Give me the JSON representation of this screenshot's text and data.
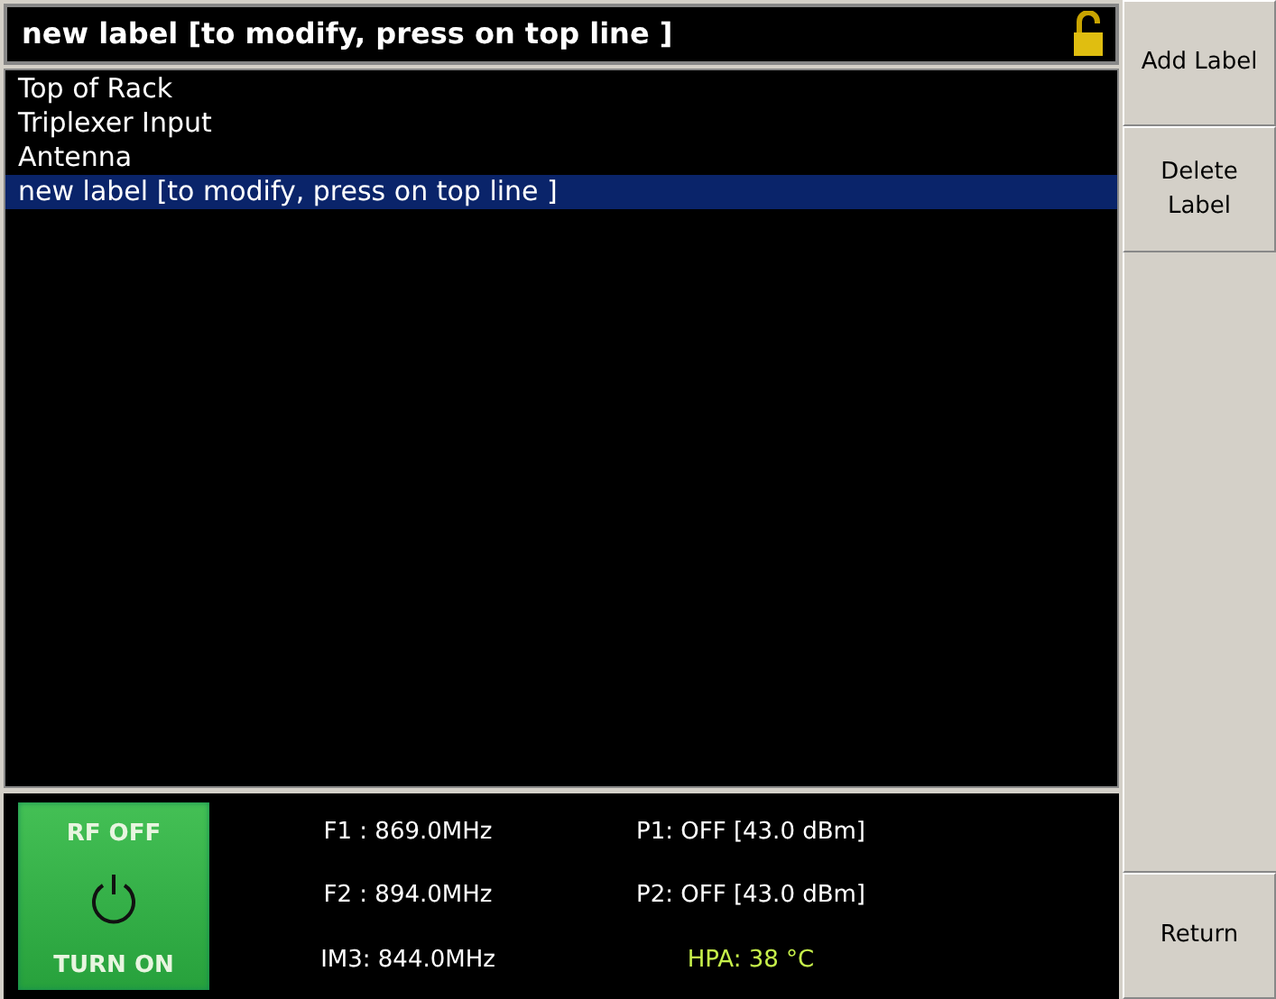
{
  "header": {
    "title": "new label [to modify, press on top line ]",
    "locked": false
  },
  "labels": [
    {
      "text": "Top of Rack",
      "selected": false
    },
    {
      "text": "Triplexer Input",
      "selected": false
    },
    {
      "text": "Antenna",
      "selected": false
    },
    {
      "text": "new label [to modify, press on top line ]",
      "selected": true
    }
  ],
  "rf_button": {
    "state": "RF OFF",
    "action": "TURN ON"
  },
  "readings": [
    {
      "text": "F1 : 869.0MHz",
      "kind": "normal"
    },
    {
      "text": "P1: OFF [43.0 dBm]",
      "kind": "normal"
    },
    {
      "text": "F2 : 894.0MHz",
      "kind": "normal"
    },
    {
      "text": "P2: OFF [43.0 dBm]",
      "kind": "normal"
    },
    {
      "text": "IM3: 844.0MHz",
      "kind": "normal"
    },
    {
      "text": "HPA: 38 °C",
      "kind": "highlight"
    }
  ],
  "softkeys_top": [
    {
      "label": "Add Label"
    },
    {
      "label": "Delete Label"
    }
  ],
  "softkeys_bottom": [
    {
      "label": "Return"
    }
  ]
}
